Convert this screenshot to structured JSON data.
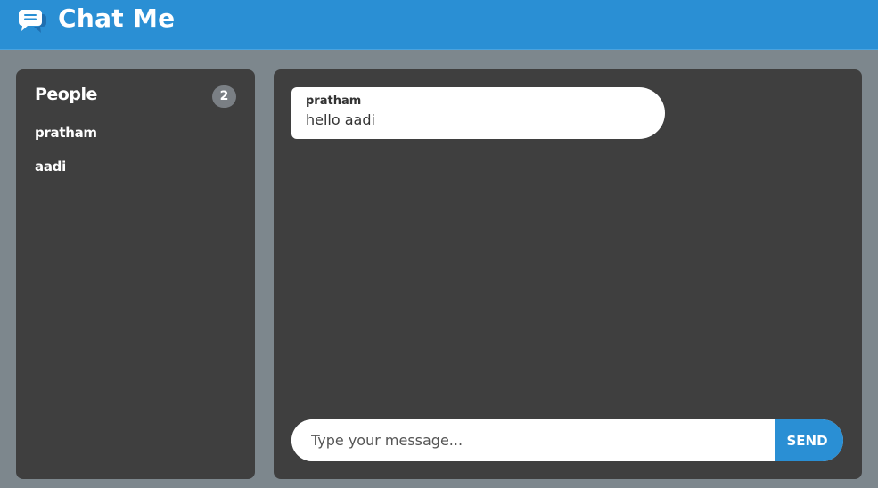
{
  "app": {
    "title": "Chat Me",
    "icon": "chat-bubbles-icon",
    "accent_color": "#2a8fd4"
  },
  "sidebar": {
    "title": "People",
    "count": "2",
    "people": [
      {
        "name": "pratham"
      },
      {
        "name": "aadi"
      }
    ]
  },
  "chat": {
    "messages": [
      {
        "author": "pratham",
        "text": "hello aadi"
      }
    ]
  },
  "composer": {
    "placeholder": "Type your message...",
    "value": "",
    "send_label": "SEND"
  }
}
